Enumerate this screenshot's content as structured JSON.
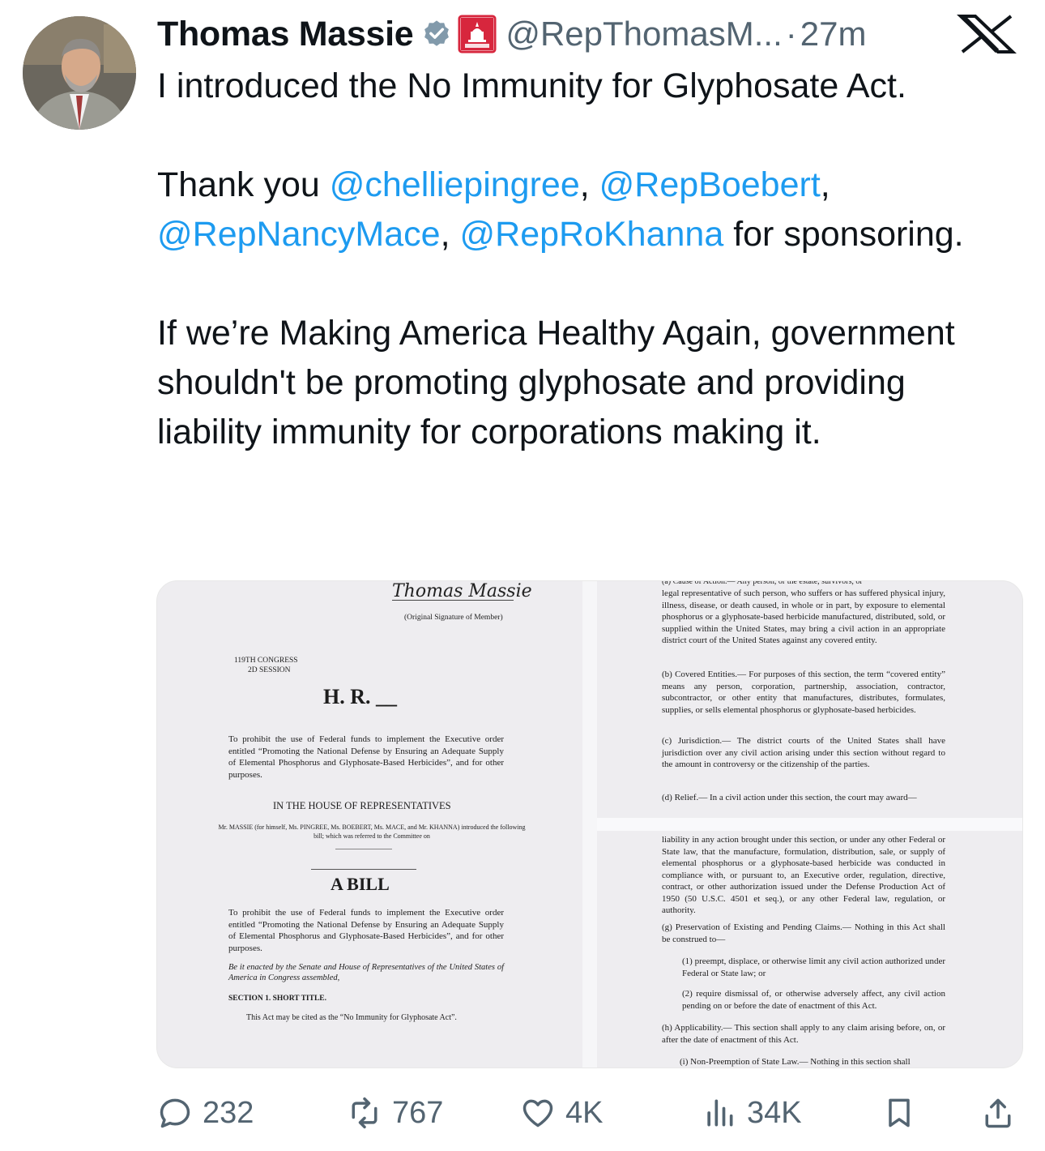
{
  "author": {
    "name": "Thomas Massie",
    "handle": "@RepThomasM...",
    "time": "27m",
    "separator": "·",
    "avatar_icon": "avatar-photo"
  },
  "tweet": {
    "line1": "I introduced the No Immunity for Glyphosate Act.",
    "thanks_prefix": "Thank you ",
    "mentions": [
      "@chelliepingree",
      "@RepBoebert",
      "@RepNancyMace",
      "@RepRoKhanna"
    ],
    "comma": ", ",
    "thanks_suffix": " for sponsoring.",
    "paragraph3": "If we’re Making America Healthy Again, government shouldn't be promoting glyphosate and providing liability immunity for corporations making it."
  },
  "document": {
    "signature": "Thomas Massie",
    "signature_caption": "(Original Signature of Member)",
    "congress": "119TH CONGRESS",
    "session": "2D SESSION",
    "bill_no": "H. R. __",
    "purpose1": "To prohibit the use of Federal funds to implement the Executive order entitled “Promoting the National Defense by Ensuring an Adequate Supply of Elemental Phosphorus and Glyphosate-Based Herbicides”, and for other purposes.",
    "house": "IN THE HOUSE OF REPRESENTATIVES",
    "sponsors": "Mr. MASSIE (for himself, Ms. PINGREE, Ms. BOEBERT, Ms. MACE, and Mr. KHANNA) introduced the following bill; which was referred to the Committee on",
    "a_bill": "A BILL",
    "purpose2": "To prohibit the use of Federal funds to implement the Executive order entitled “Promoting the National Defense by Ensuring an Adequate Supply of Elemental Phosphorus and Glyphosate-Based Herbicides”, and for other purposes.",
    "enacting": "Be it enacted by the Senate and House of Representatives of the United States of America in Congress assembled,",
    "section1_title": "SECTION 1. SHORT TITLE.",
    "section1_body": "This Act may be cited as the “No Immunity for Glyphosate Act”.",
    "right_a_top": "(a) Cause of Action.— Any person, or the estate, survivors, or",
    "right_a": "legal representative of such person, who suffers or has suffered physical injury, illness, disease, or death caused, in whole or in part, by exposure to elemental phosphorus or a glyphosate-based herbicide manufactured, distributed, sold, or supplied within the United States, may bring a civil action in an appropriate district court of the United States against any covered entity.",
    "right_b": "(b) Covered Entities.— For purposes of this section, the term “covered entity” means any person, corporation, partnership, association, contractor, subcontractor, or other entity that manufactures, distributes, formulates, supplies, or sells elemental phosphorus or glyphosate-based herbicides.",
    "right_c": "(c) Jurisdiction.— The district courts of the United States shall have jurisdiction over any civil action arising under this section without regard to the amount in controversy or the citizenship of the parties.",
    "right_d": "(d) Relief.— In a civil action under this section, the court may award—",
    "right_f": "liability in any action brought under this section, or under any other Federal or State law, that the manufacture, formulation, distribution, sale, or supply of elemental phosphorus or a glyphosate-based herbicide was conducted in compliance with, or pursuant to, an Executive order, regulation, directive, contract, or other authorization issued under the Defense Production Act of 1950 (50 U.S.C. 4501 et seq.), or any other Federal law, regulation, or authority.",
    "right_g": "(g) Preservation of Existing and Pending Claims.— Nothing in this Act shall be construed to—",
    "right_g1": "(1) preempt, displace, or otherwise limit any civil action authorized under Federal or State law; or",
    "right_g2": "(2) require dismissal of, or otherwise adversely affect, any civil action pending on or before the date of enactment of this Act.",
    "right_h": "(h) Applicability.— This section shall apply to any claim arising before, on, or after the date of enactment of this Act.",
    "right_i": "(i) Non-Preemption of State Law.— Nothing in this section shall"
  },
  "actions": {
    "replies": "232",
    "reposts": "767",
    "likes": "4K",
    "views": "34K"
  },
  "colors": {
    "link": "#1d9bf0",
    "secondary_text": "#536471",
    "verified": "#829aab",
    "affiliation_badge": "#d7263d"
  }
}
